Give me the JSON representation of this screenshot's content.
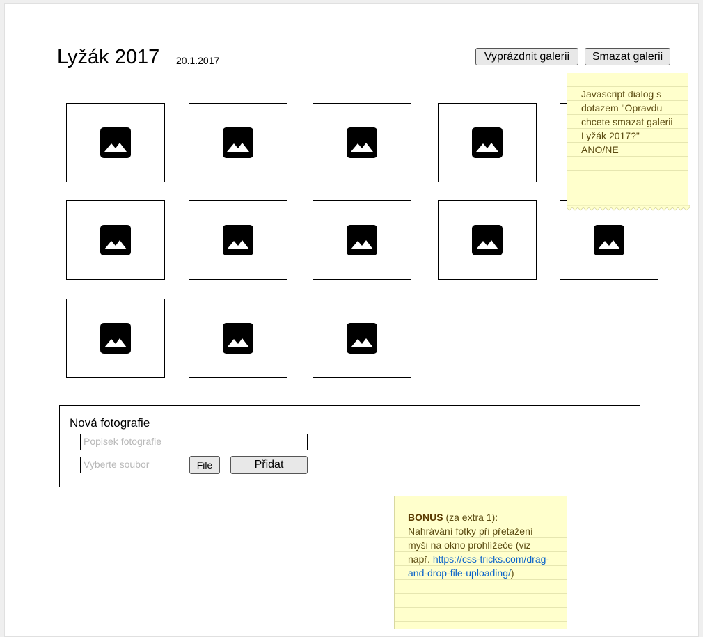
{
  "gallery": {
    "title": "Lyžák 2017",
    "date": "20.1.2017"
  },
  "toolbar": {
    "empty_label": "Vyprázdnit galerii",
    "delete_label": "Smazat galerii"
  },
  "photos": [
    {
      "icon": "image-icon"
    },
    {
      "icon": "image-icon"
    },
    {
      "icon": "image-icon"
    },
    {
      "icon": "image-icon"
    },
    {
      "icon": "image-icon"
    },
    {
      "icon": "image-icon"
    },
    {
      "icon": "image-icon"
    },
    {
      "icon": "image-icon"
    },
    {
      "icon": "image-icon"
    },
    {
      "icon": "image-icon"
    },
    {
      "icon": "image-icon"
    },
    {
      "icon": "image-icon"
    },
    {
      "icon": "image-icon"
    }
  ],
  "new_photo": {
    "title": "Nová fotografie",
    "caption_placeholder": "Popisek fotografie",
    "file_placeholder": "Vyberte soubor",
    "file_button_label": "File",
    "add_button_label": "Přidat"
  },
  "notes": {
    "dialog_note": {
      "lines": [
        "Javascript dialog s",
        "dotazem \"Opravdu",
        "chcete smazat galerii",
        "Lyžák 2017?\"",
        "ANO/NE"
      ]
    },
    "bonus_note": {
      "bold": "BONUS",
      "rest_line1": " (za extra 1):",
      "line2": "Nahrávání fotky při přetažení",
      "line3": "myši na okno prohlížeče (viz",
      "line4_prefix": "např. ",
      "link_part1": "https://css-tricks.com/drag-",
      "link_part2": "and-drop-file-uploading/",
      "line5_suffix": ")"
    }
  },
  "colors": {
    "note_background": "#ffffcc",
    "link": "#0b63c9",
    "button_background": "#e8e8e8"
  }
}
